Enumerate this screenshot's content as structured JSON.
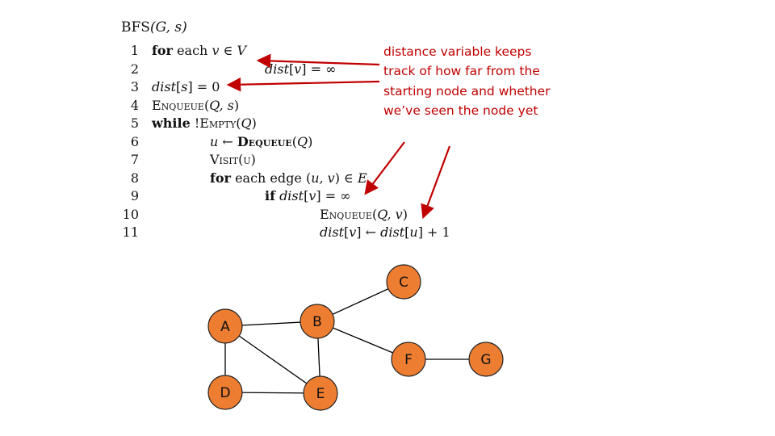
{
  "algorithm": {
    "title": "BFS(G, s)",
    "title_parts": {
      "name": "BFS",
      "args": "(G, s)"
    },
    "lines": [
      {
        "num": "1",
        "indent": 0,
        "parts": [
          {
            "t": "for",
            "s": "kw"
          },
          {
            "t": " each ",
            "s": "rm"
          },
          {
            "t": "v ∈ V",
            "s": "m"
          }
        ]
      },
      {
        "num": "2",
        "indent": 2,
        "parts": [
          {
            "t": "dist",
            "s": "m"
          },
          {
            "t": "[",
            "s": "rm"
          },
          {
            "t": "v",
            "s": "m"
          },
          {
            "t": "] = ∞",
            "s": "rm"
          }
        ]
      },
      {
        "num": "3",
        "indent": 0,
        "parts": [
          {
            "t": "dist",
            "s": "m"
          },
          {
            "t": "[",
            "s": "rm"
          },
          {
            "t": "s",
            "s": "m"
          },
          {
            "t": "] = 0",
            "s": "rm"
          }
        ]
      },
      {
        "num": "4",
        "indent": 0,
        "parts": [
          {
            "t": "Enqueue",
            "s": "sc"
          },
          {
            "t": "(",
            "s": "rm"
          },
          {
            "t": "Q, s",
            "s": "m"
          },
          {
            "t": ")",
            "s": "rm"
          }
        ]
      },
      {
        "num": "5",
        "indent": 0,
        "parts": [
          {
            "t": "while",
            "s": "kw"
          },
          {
            "t": " !",
            "s": "rm"
          },
          {
            "t": "Empty",
            "s": "sc"
          },
          {
            "t": "(",
            "s": "rm"
          },
          {
            "t": "Q",
            "s": "m"
          },
          {
            "t": ")",
            "s": "rm"
          }
        ]
      },
      {
        "num": "6",
        "indent": 1,
        "parts": [
          {
            "t": "u",
            "s": "m"
          },
          {
            "t": " ← ",
            "s": "rm"
          },
          {
            "t": "Dequeue",
            "s": "sckw"
          },
          {
            "t": "(",
            "s": "rm"
          },
          {
            "t": "Q",
            "s": "m"
          },
          {
            "t": ")",
            "s": "rm"
          }
        ]
      },
      {
        "num": "7",
        "indent": 1,
        "parts": [
          {
            "t": "Visit",
            "s": "sc"
          },
          {
            "t": "(",
            "s": "rm"
          },
          {
            "t": "u",
            "s": "sc"
          },
          {
            "t": ")",
            "s": "rm"
          }
        ]
      },
      {
        "num": "8",
        "indent": 1,
        "parts": [
          {
            "t": "for",
            "s": "kw"
          },
          {
            "t": " each edge (",
            "s": "rm"
          },
          {
            "t": "u, v",
            "s": "m"
          },
          {
            "t": ") ∈ ",
            "s": "rm"
          },
          {
            "t": "E",
            "s": "m"
          }
        ]
      },
      {
        "num": "9",
        "indent": 2,
        "parts": [
          {
            "t": "if",
            "s": "kw"
          },
          {
            "t": " ",
            "s": "rm"
          },
          {
            "t": "dist",
            "s": "m"
          },
          {
            "t": "[",
            "s": "rm"
          },
          {
            "t": "v",
            "s": "m"
          },
          {
            "t": "] = ∞",
            "s": "rm"
          }
        ]
      },
      {
        "num": "10",
        "indent": 3,
        "parts": [
          {
            "t": "Enqueue",
            "s": "sc"
          },
          {
            "t": "(",
            "s": "rm"
          },
          {
            "t": "Q, v",
            "s": "m"
          },
          {
            "t": ")",
            "s": "rm"
          }
        ]
      },
      {
        "num": "11",
        "indent": 3,
        "parts": [
          {
            "t": "dist",
            "s": "m"
          },
          {
            "t": "[",
            "s": "rm"
          },
          {
            "t": "v",
            "s": "m"
          },
          {
            "t": "] ← ",
            "s": "rm"
          },
          {
            "t": "dist",
            "s": "m"
          },
          {
            "t": "[",
            "s": "rm"
          },
          {
            "t": "u",
            "s": "m"
          },
          {
            "t": "] + 1",
            "s": "rm"
          }
        ]
      }
    ]
  },
  "annotation": {
    "text": "distance variable keeps track of how far from the starting node and whether we’ve seen the node yet",
    "color": "#c00000"
  },
  "graph": {
    "node_color": "#ed7d31",
    "edge_color": "#000000",
    "nodes": [
      {
        "id": "A",
        "label": "A"
      },
      {
        "id": "B",
        "label": "B"
      },
      {
        "id": "C",
        "label": "C"
      },
      {
        "id": "D",
        "label": "D"
      },
      {
        "id": "E",
        "label": "E"
      },
      {
        "id": "F",
        "label": "F"
      },
      {
        "id": "G",
        "label": "G"
      }
    ],
    "edges": [
      [
        "A",
        "B"
      ],
      [
        "A",
        "D"
      ],
      [
        "A",
        "E"
      ],
      [
        "B",
        "C"
      ],
      [
        "B",
        "E"
      ],
      [
        "B",
        "F"
      ],
      [
        "D",
        "E"
      ],
      [
        "F",
        "G"
      ]
    ]
  }
}
